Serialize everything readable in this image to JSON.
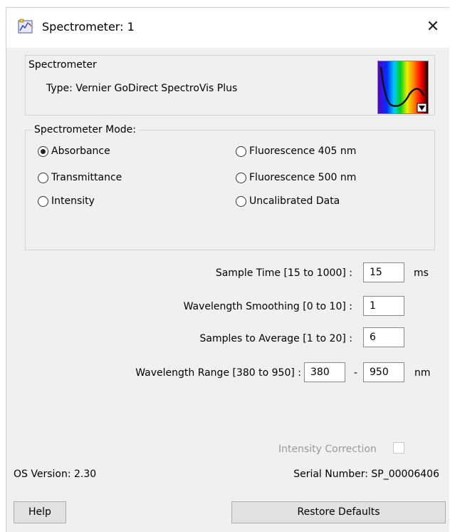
{
  "window": {
    "title": "Spectrometer: 1",
    "close_glyph": "✕",
    "icon": "spectrometer-app-icon"
  },
  "spectrometer": {
    "heading": "Spectrometer",
    "type": "Type: Vernier GoDirect SpectroVis Plus",
    "graph_icon": "spectrum-graph-icon"
  },
  "mode": {
    "legend": "Spectrometer Mode:",
    "options": [
      {
        "label": "Absorbance",
        "selected": true
      },
      {
        "label": "Transmittance",
        "selected": false
      },
      {
        "label": "Intensity",
        "selected": false
      },
      {
        "label": "Fluorescence 405 nm",
        "selected": false
      },
      {
        "label": "Fluorescence 500 nm",
        "selected": false
      },
      {
        "label": "Uncalibrated Data",
        "selected": false
      }
    ]
  },
  "settings": {
    "sample_time": {
      "label": "Sample Time [15 to 1000] :",
      "value": "15",
      "unit": "ms"
    },
    "smoothing": {
      "label": "Wavelength Smoothing [0 to 10] :",
      "value": "1"
    },
    "samples_avg": {
      "label": "Samples to Average [1 to 20] :",
      "value": "6"
    },
    "range": {
      "label": "Wavelength Range [380 to 950] :",
      "min": "380",
      "separator": "-",
      "max": "950",
      "unit": "nm"
    }
  },
  "intensity_correction": {
    "label": "Intensity Correction",
    "checked": false,
    "enabled": false
  },
  "footer": {
    "os_version": "OS Version: 2.30",
    "serial": "Serial Number: SP_00006406"
  },
  "buttons": {
    "help": "Help",
    "restore": "Restore Defaults"
  }
}
